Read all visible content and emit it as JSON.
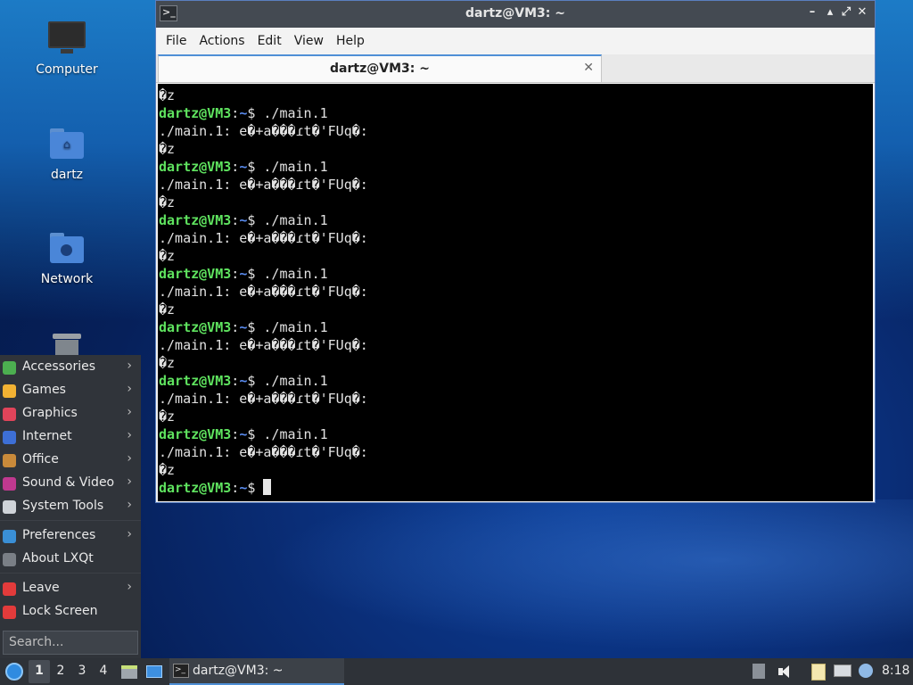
{
  "desktop": {
    "icons": [
      {
        "label": "Computer"
      },
      {
        "label": "dartz"
      },
      {
        "label": "Network"
      }
    ]
  },
  "window": {
    "title": "dartz@VM3: ~",
    "controls": {
      "minimize": "–",
      "restore": "▴",
      "maximize": "⤢",
      "close": "✕"
    },
    "menu": [
      "File",
      "Actions",
      "Edit",
      "View",
      "Help"
    ],
    "tab": {
      "label": "dartz@VM3: ~",
      "close": "✕"
    }
  },
  "terminal": {
    "user": "dartz@VM3",
    "sep": ":",
    "path": "~",
    "prompt_char": "$",
    "command": "./main.1",
    "first_line": "�z",
    "output": "./main.1: e�+a���ɾt�'FUq�:",
    "output_tail": "�z",
    "repeats": 7
  },
  "start_menu": {
    "items": [
      {
        "label": "Accessories",
        "arrow": "›",
        "color": "#4caf50"
      },
      {
        "label": "Games",
        "arrow": "›",
        "color": "#f2b233"
      },
      {
        "label": "Graphics",
        "arrow": "›",
        "color": "#e0445a"
      },
      {
        "label": "Internet",
        "arrow": "›",
        "color": "#3d6fd6"
      },
      {
        "label": "Office",
        "arrow": "›",
        "color": "#c98a3a"
      },
      {
        "label": "Sound & Video",
        "arrow": "›",
        "color": "#c0398f"
      },
      {
        "label": "System Tools",
        "arrow": "›",
        "color": "#cfd3d8"
      },
      {
        "label": "Preferences",
        "arrow": "›",
        "color": "#3a8fd6"
      },
      {
        "label": "About LXQt",
        "arrow": "",
        "color": "#7a7f86"
      },
      {
        "label": "Leave",
        "arrow": "›",
        "color": "#e23b3b"
      },
      {
        "label": "Lock Screen",
        "arrow": "",
        "color": "#e23b3b"
      }
    ],
    "search_placeholder": "Search..."
  },
  "taskbar": {
    "desktops": [
      "1",
      "2",
      "3",
      "4"
    ],
    "task": {
      "label": "dartz@VM3: ~"
    },
    "clock": "8:18"
  }
}
